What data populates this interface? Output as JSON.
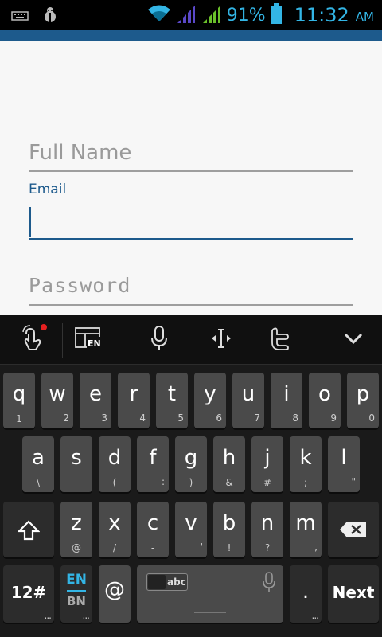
{
  "status_bar": {
    "battery_percent": "91%",
    "time": "11:32",
    "ampm": "AM",
    "accent_color": "#33b5e5",
    "icons": [
      "keyboard-icon",
      "debug-icon",
      "wifi-icon",
      "signal-icon",
      "signal-icon-2",
      "battery-icon"
    ]
  },
  "form": {
    "full_name_placeholder": "Full Name",
    "email_label": "Email",
    "password_placeholder": "Password",
    "accent_color": "#1d5a8c"
  },
  "keyboard_toolbar": {
    "icons": [
      "gesture-icon",
      "language-layout-icon",
      "microphone-icon",
      "cursor-move-icon",
      "twitter-icon",
      "collapse-keyboard-icon"
    ],
    "layout_badge": "EN"
  },
  "keyboard": {
    "row1": [
      {
        "key": "q",
        "hint": "1"
      },
      {
        "key": "w",
        "hint": "2"
      },
      {
        "key": "e",
        "hint": "3"
      },
      {
        "key": "r",
        "hint": "4"
      },
      {
        "key": "t",
        "hint": "5"
      },
      {
        "key": "y",
        "hint": "6"
      },
      {
        "key": "u",
        "hint": "7"
      },
      {
        "key": "i",
        "hint": "8"
      },
      {
        "key": "o",
        "hint": "9"
      },
      {
        "key": "p",
        "hint": "0"
      }
    ],
    "row2": [
      {
        "key": "a",
        "hint": "\\"
      },
      {
        "key": "s",
        "hint": "_"
      },
      {
        "key": "d",
        "hint": "("
      },
      {
        "key": "f",
        "hint": ":"
      },
      {
        "key": "g",
        "hint": ")"
      },
      {
        "key": "h",
        "hint": "&"
      },
      {
        "key": "j",
        "hint": "#"
      },
      {
        "key": "k",
        "hint": ";"
      },
      {
        "key": "l",
        "hint": "\""
      }
    ],
    "row3": [
      {
        "key": "z",
        "hint": "@"
      },
      {
        "key": "x",
        "hint": "/"
      },
      {
        "key": "c",
        "hint": "-"
      },
      {
        "key": "v",
        "hint": "'"
      },
      {
        "key": "b",
        "hint": "!"
      },
      {
        "key": "n",
        "hint": "?"
      },
      {
        "key": "m",
        "hint": ","
      }
    ],
    "symbols_label": "12#",
    "lang_top": "EN",
    "lang_bottom": "BN",
    "at_label": "@",
    "space_badge": "abc",
    "period_label": ".",
    "next_label": "Next"
  }
}
